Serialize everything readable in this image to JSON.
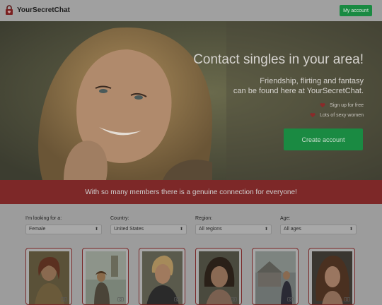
{
  "header": {
    "logo_text": "YourSecretChat",
    "account_button": "My account"
  },
  "hero": {
    "title": "Contact singles in your area!",
    "subtitle_line1": "Friendship, flirting and fantasy",
    "subtitle_line2": "can be found here at YourSecretChat.",
    "bullets": [
      "Sign up for free",
      "Lots of sexy women"
    ],
    "cta_button": "Create account"
  },
  "banner": {
    "text": "With so many members there is a genuine connection for everyone!"
  },
  "filters": [
    {
      "label": "I'm looking for a:",
      "value": "Female"
    },
    {
      "label": "Country:",
      "value": "United States"
    },
    {
      "label": "Region:",
      "value": "All regions"
    },
    {
      "label": "Age:",
      "value": "All ages"
    }
  ],
  "colors": {
    "accent_green": "#1a8a42",
    "banner_red": "#7d2828",
    "bullet_heart": "#8a2a2a"
  },
  "icons": {
    "logo": "lock-heart-icon",
    "bullet": "heart-icon",
    "card_badge": "camera-icon",
    "select": "up-down-arrow-icon"
  }
}
